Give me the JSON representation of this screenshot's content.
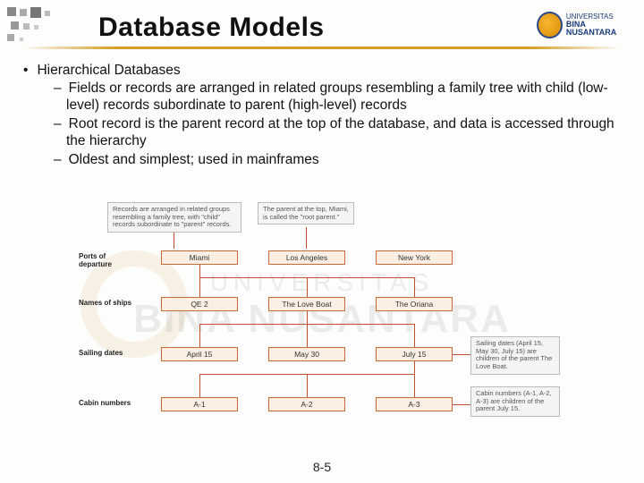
{
  "title": "Database Models",
  "bullets": {
    "main": "Hierarchical Databases",
    "s1": "Fields or records are arranged in related groups resembling a family tree with child (low-level) records subordinate to parent (high-level) records",
    "s2": "Root record is the parent record at the top of the database, and data is accessed through the hierarchy",
    "s3": "Oldest and simplest; used in mainframes"
  },
  "diagram": {
    "callout_records": "Records are arranged in related groups resembling a family tree, with \"child\" records subordinate to \"parent\" records.",
    "callout_root": "The parent at the top, Miami, is called the \"root parent.\"",
    "callout_dates": "Sailing dates (April 15, May 30, July 15) are children of the parent The Love Boat.",
    "callout_cabins": "Cabin numbers (A-1, A-2, A-3) are children of the parent July 15.",
    "row_labels": {
      "ports": "Ports of departure",
      "ships": "Names of ships",
      "dates": "Sailing dates",
      "cabins": "Cabin numbers"
    },
    "nodes": {
      "miami": "Miami",
      "la": "Los Angeles",
      "ny": "New York",
      "qe2": "QE 2",
      "love": "The Love Boat",
      "oriana": "The Oriana",
      "apr15": "April 15",
      "may30": "May 30",
      "jul15": "July 15",
      "a1": "A-1",
      "a2": "A-2",
      "a3": "A-3"
    }
  },
  "watermark": {
    "line1": "UNIVERSITAS",
    "line2": "BINA NUSANTARA"
  },
  "logo": {
    "univ": "UNIVERSITAS",
    "name": "BINA NUSANTARA"
  },
  "footer": "8-5"
}
